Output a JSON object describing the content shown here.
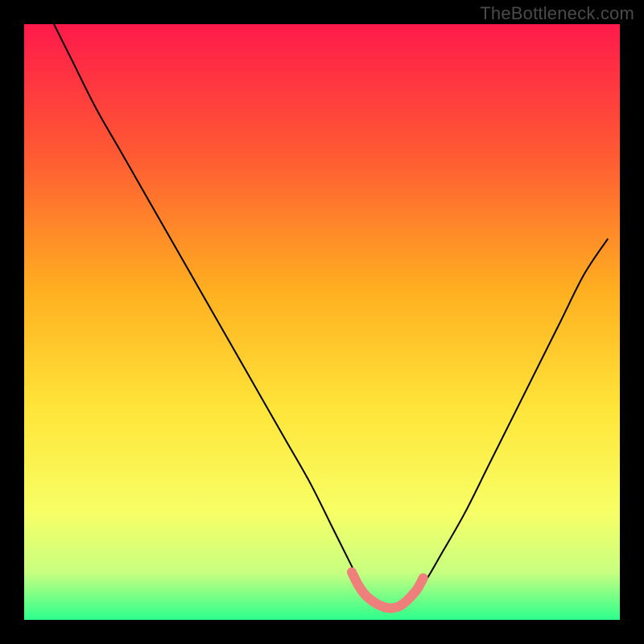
{
  "watermark": "TheBottleneck.com",
  "chart_data": {
    "type": "line",
    "title": "",
    "xlabel": "",
    "ylabel": "",
    "xlim": [
      0,
      100
    ],
    "ylim": [
      0,
      100
    ],
    "background_gradient": {
      "stops": [
        {
          "offset": 0.0,
          "color": "#ff1a4b"
        },
        {
          "offset": 0.22,
          "color": "#ff5a33"
        },
        {
          "offset": 0.45,
          "color": "#ffb020"
        },
        {
          "offset": 0.65,
          "color": "#ffe63a"
        },
        {
          "offset": 0.82,
          "color": "#f7ff66"
        },
        {
          "offset": 0.92,
          "color": "#c8ff80"
        },
        {
          "offset": 1.0,
          "color": "#2cff8c"
        }
      ]
    },
    "series": [
      {
        "name": "bottleneck-curve",
        "color": "#000000",
        "x": [
          5,
          8,
          12,
          16,
          20,
          24,
          28,
          32,
          36,
          40,
          44,
          48,
          52,
          55,
          57,
          60,
          62,
          64,
          67,
          70,
          74,
          78,
          82,
          86,
          90,
          94,
          98
        ],
        "y": [
          100,
          94,
          86,
          79,
          72,
          65,
          58,
          51,
          44,
          37,
          30,
          23,
          15,
          9,
          5,
          2,
          2,
          3,
          6,
          11,
          18,
          26,
          34,
          42,
          50,
          58,
          64
        ]
      },
      {
        "name": "optimal-region",
        "color": "#ef7f7a",
        "x": [
          55,
          56,
          57,
          58,
          59,
          60,
          61,
          62,
          63,
          64,
          65,
          66,
          67
        ],
        "y": [
          8,
          6,
          4.5,
          3.5,
          2.8,
          2.3,
          2.0,
          2.0,
          2.3,
          3.0,
          4.0,
          5.2,
          7
        ]
      }
    ]
  }
}
